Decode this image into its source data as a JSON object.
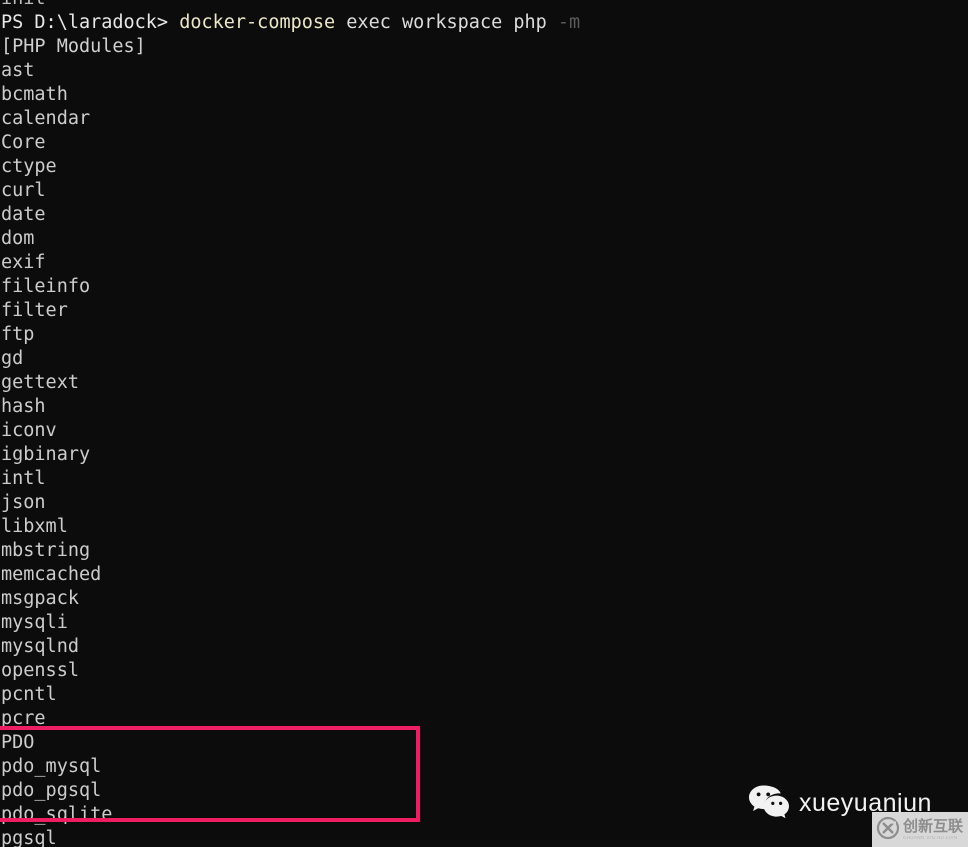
{
  "terminal": {
    "background_color": "#0c0c0c",
    "foreground_color": "#cccccc",
    "clipped_top_line": "init",
    "prompt": {
      "prefix": "PS D:\\laradock> ",
      "command": "docker-compose",
      "args": " exec workspace php ",
      "flag": "-m"
    },
    "output_header": "[PHP Modules]",
    "modules": [
      "ast",
      "bcmath",
      "calendar",
      "Core",
      "ctype",
      "curl",
      "date",
      "dom",
      "exif",
      "fileinfo",
      "filter",
      "ftp",
      "gd",
      "gettext",
      "hash",
      "iconv",
      "igbinary",
      "intl",
      "json",
      "libxml",
      "mbstring",
      "memcached",
      "msgpack",
      "mysqli",
      "mysqlnd",
      "openssl",
      "pcntl",
      "pcre",
      "PDO",
      "pdo_mysql",
      "pdo_pgsql",
      "pdo_sqlite",
      "pgsql"
    ]
  },
  "annotation": {
    "highlight_color": "#ef1e63",
    "highlighted_modules": [
      "PDO",
      "pdo_mysql",
      "pdo_pgsql",
      "pdo_sqlite"
    ]
  },
  "watermarks": {
    "wechat": {
      "icon": "wechat-icon",
      "label": "xueyuanjun"
    },
    "site": {
      "icon": "circle-x-logo-icon",
      "chinese_text": "创新互联",
      "pinyin_text": "CHUANG XIN HU LIAN",
      "background_color": "#d8d8d8"
    }
  }
}
